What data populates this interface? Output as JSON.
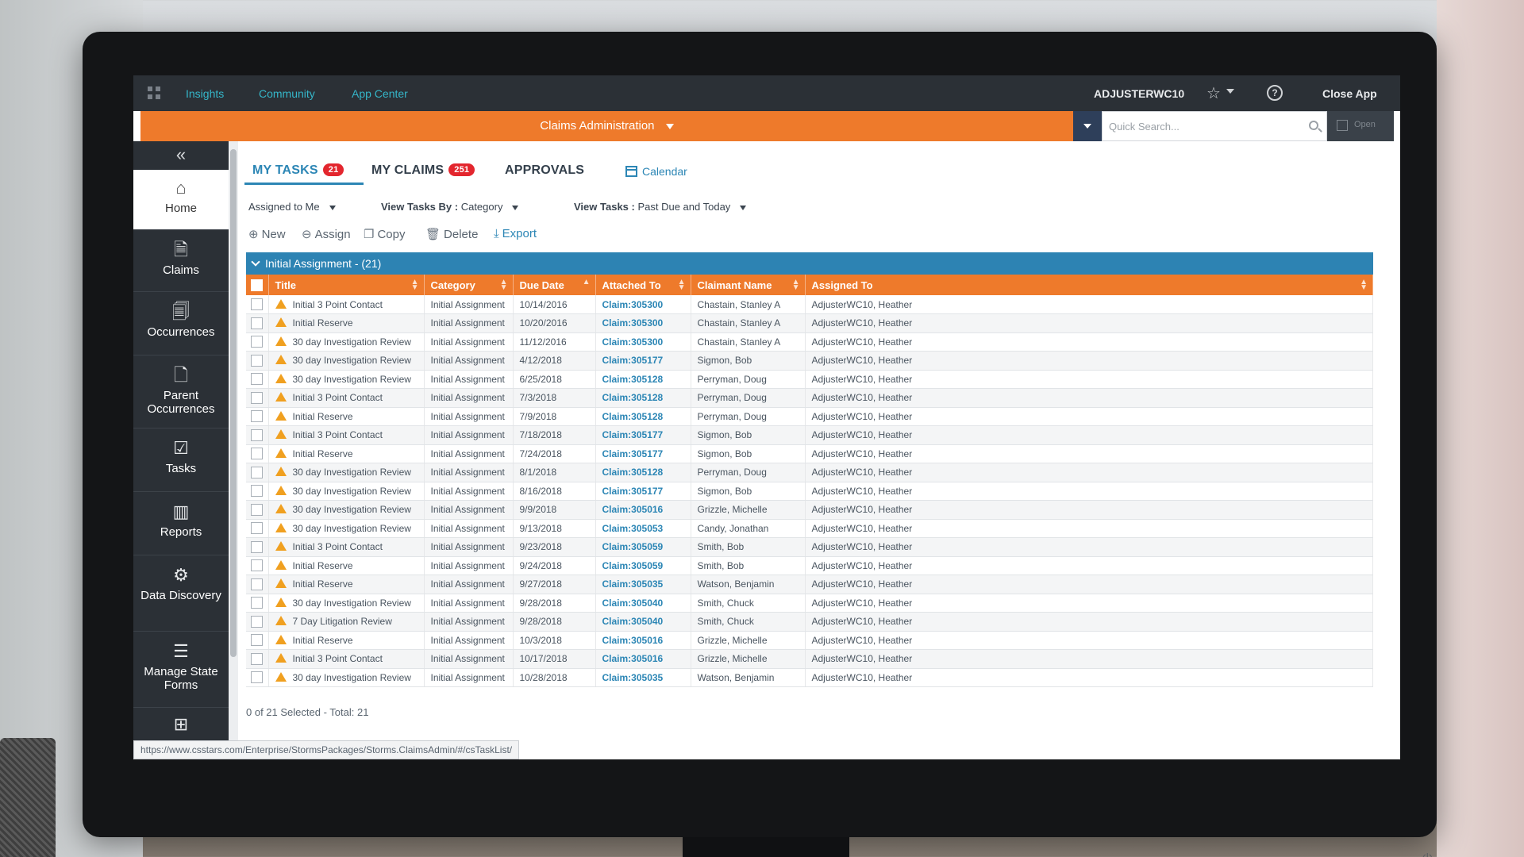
{
  "topbar": {
    "links": [
      "Insights",
      "Community",
      "App Center"
    ],
    "user": "ADJUSTERWC10",
    "close_app": "Close App"
  },
  "appbar": {
    "title": "Claims Administration",
    "quick_search_placeholder": "Quick Search...",
    "open_label": "Open"
  },
  "sidebar": {
    "items": [
      {
        "label": "Home",
        "icon": "home-icon"
      },
      {
        "label": "Claims",
        "icon": "document-icon"
      },
      {
        "label": "Occurrences",
        "icon": "documents-icon"
      },
      {
        "label": "Parent Occurrences",
        "icon": "parent-document-icon"
      },
      {
        "label": "Tasks",
        "icon": "clipboard-check-icon"
      },
      {
        "label": "Reports",
        "icon": "bar-chart-icon"
      },
      {
        "label": "Data Discovery",
        "icon": "search-gear-icon"
      },
      {
        "label": "Manage State Forms",
        "icon": "form-icon"
      }
    ]
  },
  "tabs": {
    "my_tasks": {
      "label": "MY TASKS",
      "count": "21"
    },
    "my_claims": {
      "label": "MY CLAIMS",
      "count": "251"
    },
    "approvals": {
      "label": "APPROVALS"
    },
    "calendar": {
      "label": "Calendar"
    }
  },
  "filters": {
    "assigned": "Assigned to Me",
    "view_by_label": "View Tasks By :",
    "view_by_value": "Category",
    "view_tasks_label": "View Tasks :",
    "view_tasks_value": "Past Due and Today"
  },
  "toolbar": {
    "new": "New",
    "assign": "Assign",
    "copy": "Copy",
    "delete": "Delete",
    "export": "Export"
  },
  "group": {
    "label": "Initial Assignment - (21)"
  },
  "table": {
    "columns": [
      "Title",
      "Category",
      "Due Date",
      "Attached To",
      "Claimant Name",
      "Assigned To"
    ],
    "rows": [
      [
        "Initial 3 Point Contact",
        "Initial Assignment",
        "10/14/2016",
        "Claim:305300",
        "Chastain, Stanley A",
        "AdjusterWC10, Heather"
      ],
      [
        "Initial Reserve",
        "Initial Assignment",
        "10/20/2016",
        "Claim:305300",
        "Chastain, Stanley A",
        "AdjusterWC10, Heather"
      ],
      [
        "30 day Investigation Review",
        "Initial Assignment",
        "11/12/2016",
        "Claim:305300",
        "Chastain, Stanley A",
        "AdjusterWC10, Heather"
      ],
      [
        "30 day Investigation Review",
        "Initial Assignment",
        "4/12/2018",
        "Claim:305177",
        "Sigmon, Bob",
        "AdjusterWC10, Heather"
      ],
      [
        "30 day Investigation Review",
        "Initial Assignment",
        "6/25/2018",
        "Claim:305128",
        "Perryman, Doug",
        "AdjusterWC10, Heather"
      ],
      [
        "Initial 3 Point Contact",
        "Initial Assignment",
        "7/3/2018",
        "Claim:305128",
        "Perryman, Doug",
        "AdjusterWC10, Heather"
      ],
      [
        "Initial Reserve",
        "Initial Assignment",
        "7/9/2018",
        "Claim:305128",
        "Perryman, Doug",
        "AdjusterWC10, Heather"
      ],
      [
        "Initial 3 Point Contact",
        "Initial Assignment",
        "7/18/2018",
        "Claim:305177",
        "Sigmon, Bob",
        "AdjusterWC10, Heather"
      ],
      [
        "Initial Reserve",
        "Initial Assignment",
        "7/24/2018",
        "Claim:305177",
        "Sigmon, Bob",
        "AdjusterWC10, Heather"
      ],
      [
        "30 day Investigation Review",
        "Initial Assignment",
        "8/1/2018",
        "Claim:305128",
        "Perryman, Doug",
        "AdjusterWC10, Heather"
      ],
      [
        "30 day Investigation Review",
        "Initial Assignment",
        "8/16/2018",
        "Claim:305177",
        "Sigmon, Bob",
        "AdjusterWC10, Heather"
      ],
      [
        "30 day Investigation Review",
        "Initial Assignment",
        "9/9/2018",
        "Claim:305016",
        "Grizzle, Michelle",
        "AdjusterWC10, Heather"
      ],
      [
        "30 day Investigation Review",
        "Initial Assignment",
        "9/13/2018",
        "Claim:305053",
        "Candy, Jonathan",
        "AdjusterWC10, Heather"
      ],
      [
        "Initial 3 Point Contact",
        "Initial Assignment",
        "9/23/2018",
        "Claim:305059",
        "Smith, Bob",
        "AdjusterWC10, Heather"
      ],
      [
        "Initial Reserve",
        "Initial Assignment",
        "9/24/2018",
        "Claim:305059",
        "Smith, Bob",
        "AdjusterWC10, Heather"
      ],
      [
        "Initial Reserve",
        "Initial Assignment",
        "9/27/2018",
        "Claim:305035",
        "Watson, Benjamin",
        "AdjusterWC10, Heather"
      ],
      [
        "30 day Investigation Review",
        "Initial Assignment",
        "9/28/2018",
        "Claim:305040",
        "Smith, Chuck",
        "AdjusterWC10, Heather"
      ],
      [
        "7 Day Litigation Review",
        "Initial Assignment",
        "9/28/2018",
        "Claim:305040",
        "Smith, Chuck",
        "AdjusterWC10, Heather"
      ],
      [
        "Initial Reserve",
        "Initial Assignment",
        "10/3/2018",
        "Claim:305016",
        "Grizzle, Michelle",
        "AdjusterWC10, Heather"
      ],
      [
        "Initial 3 Point Contact",
        "Initial Assignment",
        "10/17/2018",
        "Claim:305016",
        "Grizzle, Michelle",
        "AdjusterWC10, Heather"
      ],
      [
        "30 day Investigation Review",
        "Initial Assignment",
        "10/28/2018",
        "Claim:305035",
        "Watson, Benjamin",
        "AdjusterWC10, Heather"
      ]
    ]
  },
  "status": {
    "selection": "0 of 21 Selected - Total: 21"
  },
  "url_hover": "https://www.csstars.com/Enterprise/StormsPackages/Storms.ClaimsAdmin/#/csTaskList/",
  "colors": {
    "accent_orange": "#ee7a2b",
    "header_blue": "#2d83b3",
    "link_blue": "#2c86b5",
    "badge_red": "#e3262e",
    "warning_yellow": "#f0a020",
    "chrome_dark": "#2b3036"
  }
}
